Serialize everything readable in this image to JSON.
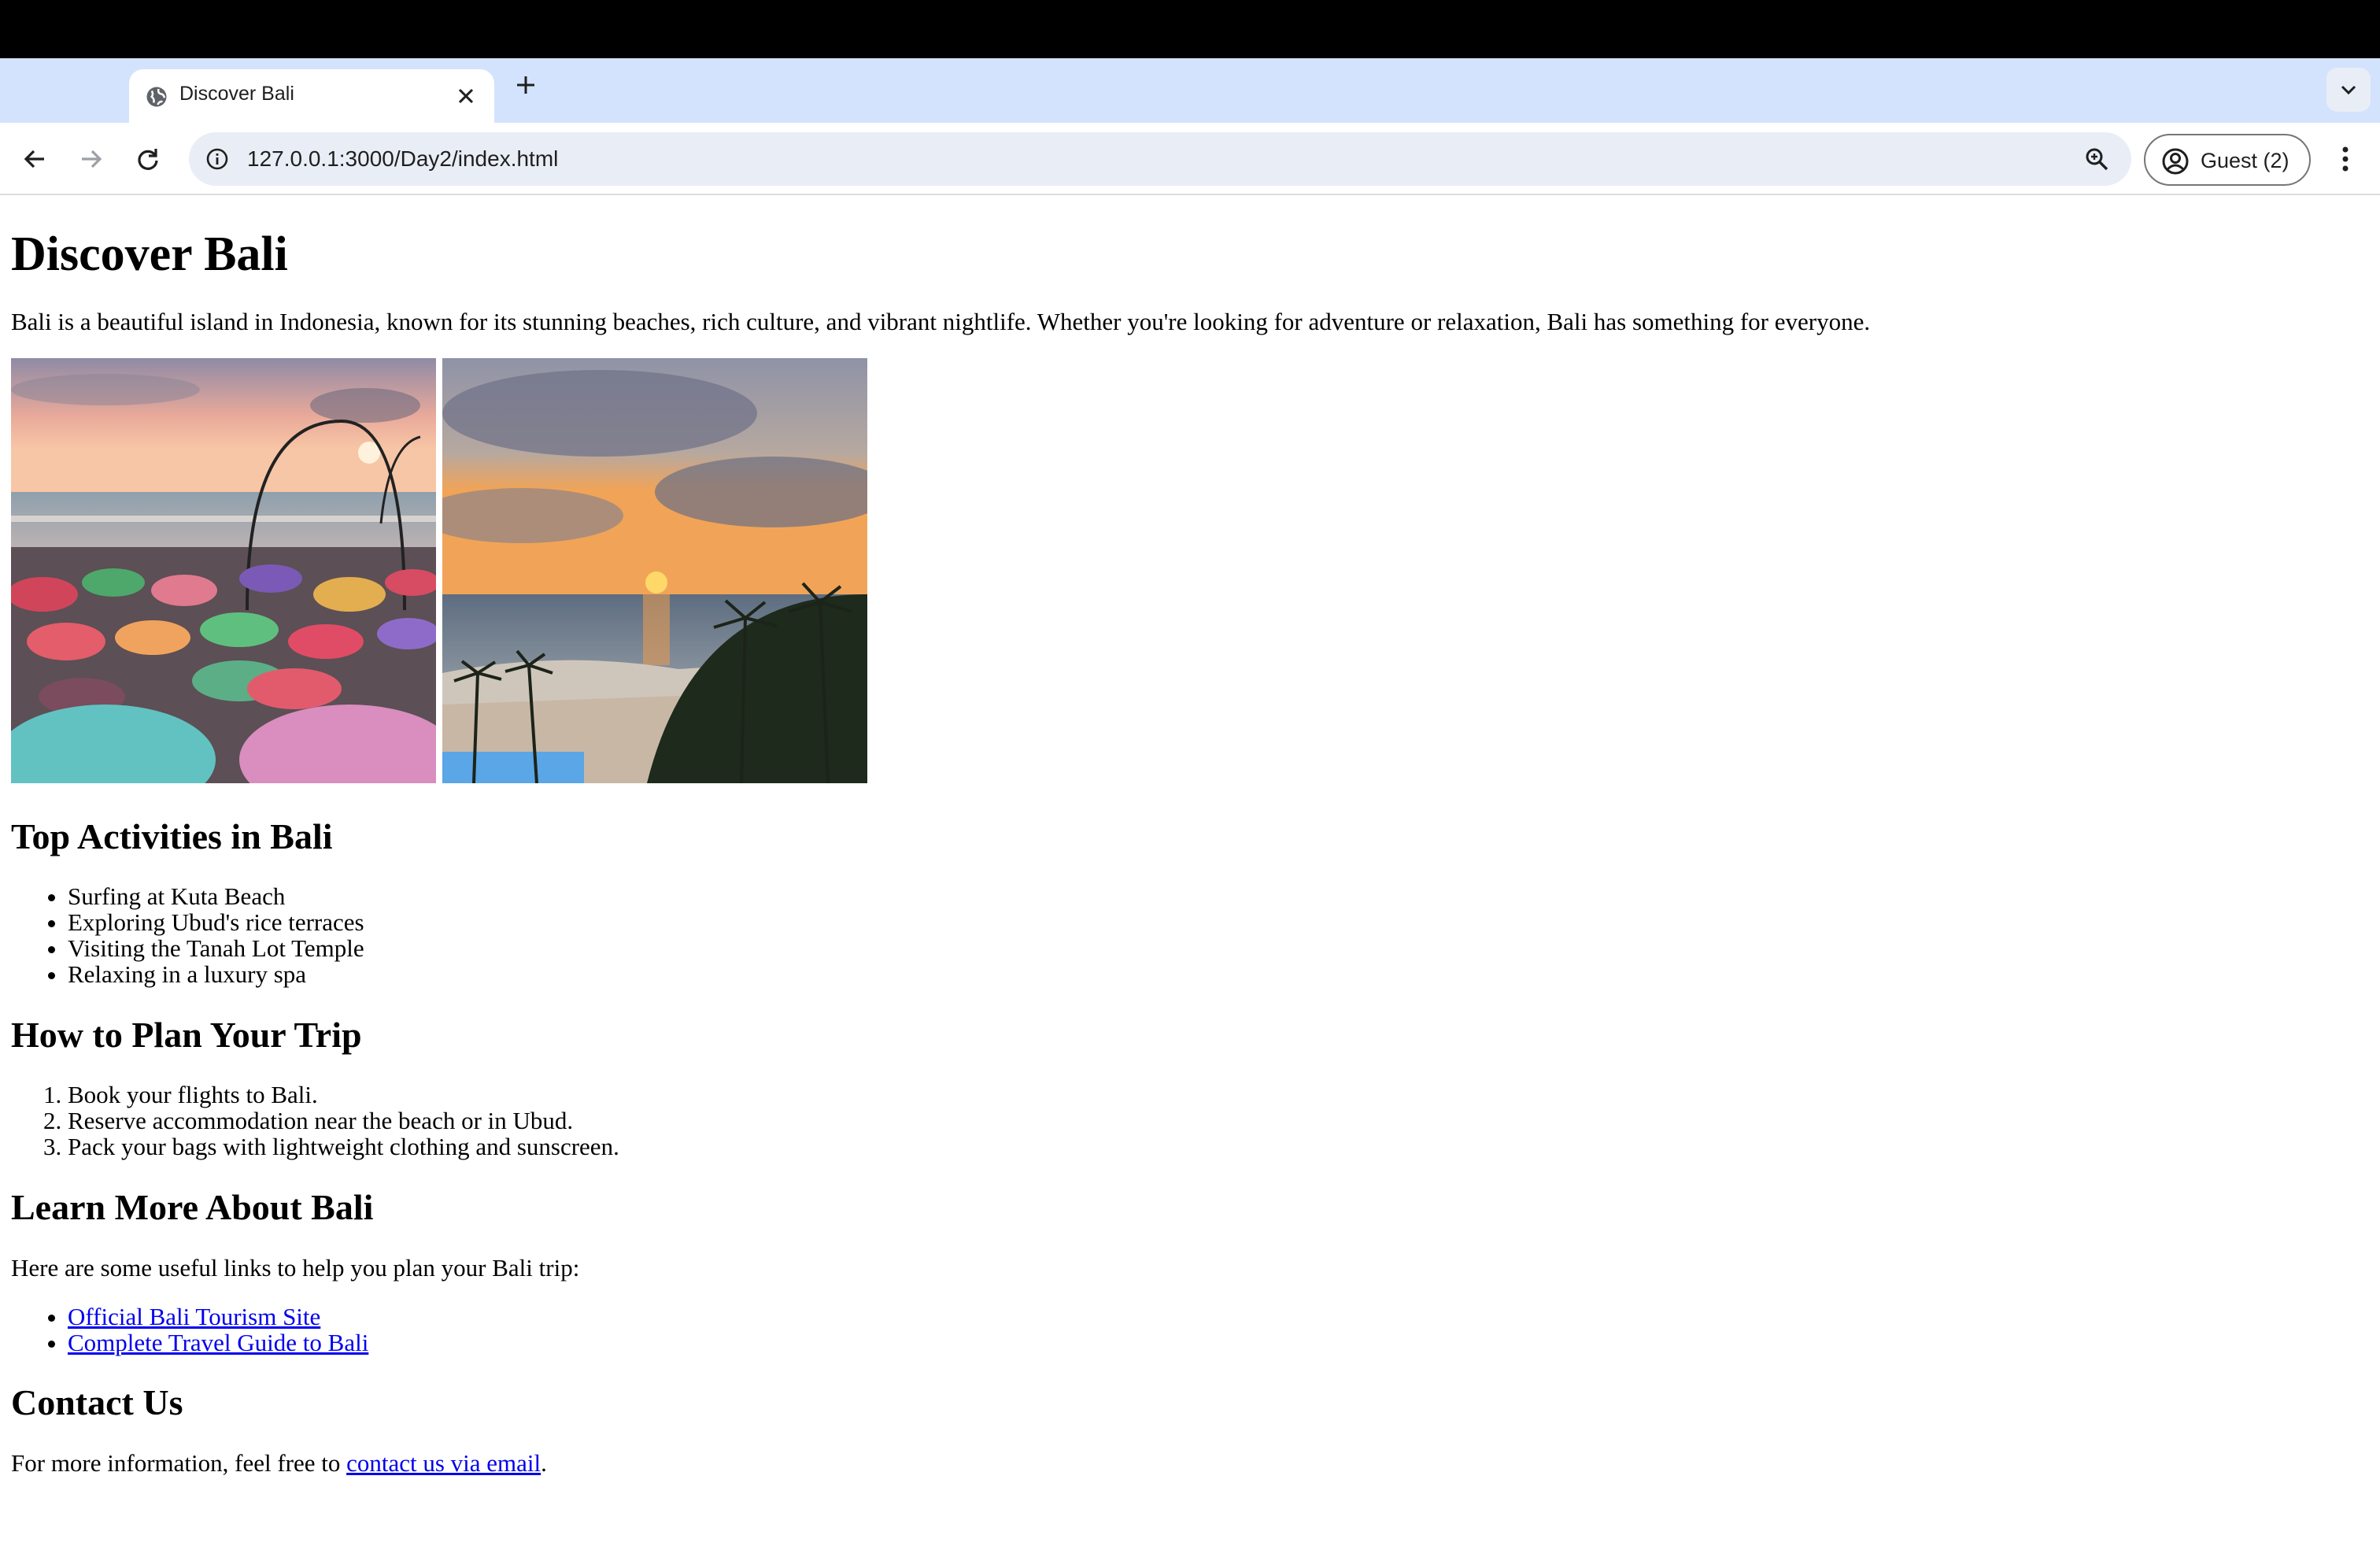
{
  "browser": {
    "tab_title": "Discover Bali",
    "url": "127.0.0.1:3000/Day2/index.html",
    "profile_label": "Guest (2)"
  },
  "page": {
    "title": "Discover Bali",
    "intro": "Bali is a beautiful island in Indonesia, known for its stunning beaches, rich culture, and vibrant nightlife. Whether you're looking for adventure or relaxation, Bali has something for everyone.",
    "activities": {
      "heading": "Top Activities in Bali",
      "items": [
        "Surfing at Kuta Beach",
        "Exploring Ubud's rice terraces",
        "Visiting the Tanah Lot Temple",
        "Relaxing in a luxury spa"
      ]
    },
    "plan": {
      "heading": "How to Plan Your Trip",
      "steps": [
        "Book your flights to Bali.",
        "Reserve accommodation near the beach or in Ubud.",
        "Pack your bags with lightweight clothing and sunscreen."
      ]
    },
    "learn_more": {
      "heading": "Learn More About Bali",
      "text": "Here are some useful links to help you plan your Bali trip:",
      "links": [
        "Official Bali Tourism Site",
        "Complete Travel Guide to Bali"
      ]
    },
    "contact": {
      "heading": "Contact Us",
      "text_before": "For more information, feel free to ",
      "link": "contact us via email",
      "text_after": "."
    }
  },
  "colors": {
    "tabstrip": "#d3e3fd",
    "omnibox": "#e9eef6",
    "link": "#0000ee"
  }
}
